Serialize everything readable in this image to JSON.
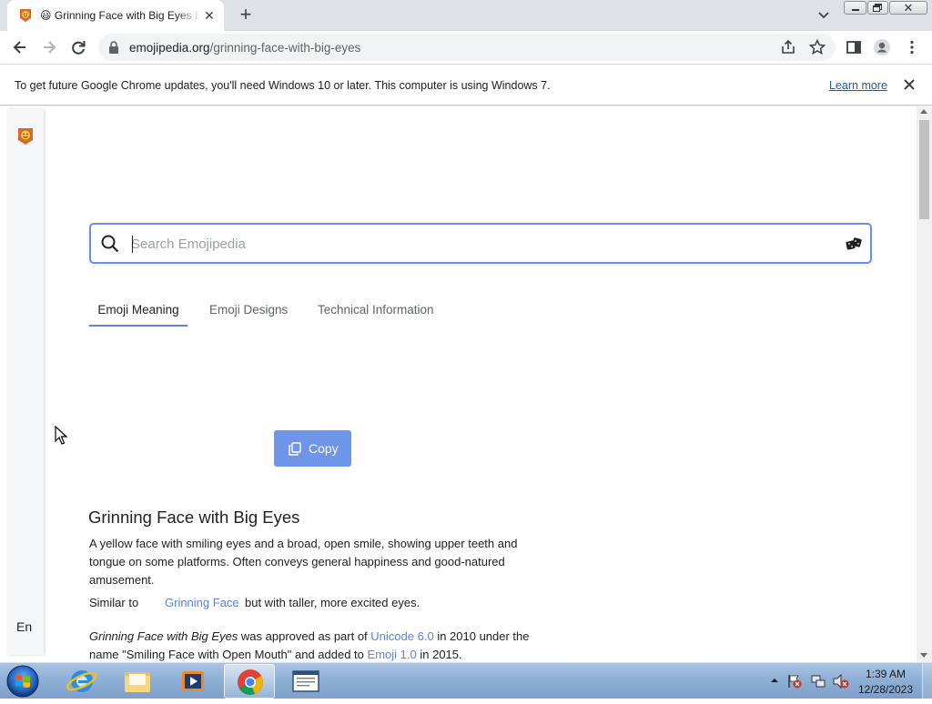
{
  "browser": {
    "tab_title": "Grinning Face with Big Eyes Emojipedia",
    "tab_title_emoji": "😃",
    "url_host": "emojipedia.org",
    "url_path": "/grinning-face-with-big-eyes"
  },
  "infobar": {
    "message": "To get future Google Chrome updates, you'll need Windows 10 or later. This computer is using Windows 7.",
    "learn_more": "Learn more"
  },
  "page": {
    "search_placeholder": "Search Emojipedia",
    "tabs": [
      "Emoji Meaning",
      "Emoji Designs",
      "Technical Information"
    ],
    "active_tab": "Emoji Meaning",
    "copy_label": "Copy",
    "heading": "Grinning Face with Big Eyes",
    "description": "A yellow face with smiling eyes and a broad, open smile, showing upper teeth and tongue on some platforms. Often conveys general happiness and good-natured amusement.",
    "similar_label": "Similar to",
    "similar_link": "Grinning Face",
    "similar_rest": "but with taller, more excited eyes.",
    "approved": {
      "name": "Grinning Face with Big Eyes",
      "text1": "was approved as part of",
      "unicode_link": "Unicode 6.0",
      "text2": "in 2010 under the name \"Smiling Face with Open Mouth\" and added to",
      "emoji_link": "Emoji 1.0",
      "text3": "in 2015."
    },
    "language": "En"
  },
  "taskbar": {
    "time": "1:39 AM",
    "date": "12/28/2023"
  },
  "colors": {
    "accent": "#5b83e3",
    "search_border": "#6b8fe6",
    "copy_button": "#6e95e8",
    "tab_strip": "#dee1e6",
    "taskbar": "#8fb0d6"
  },
  "icons": [
    "emojipedia-logo-icon",
    "close-icon",
    "new-tab-icon",
    "tab-search-icon",
    "back-icon",
    "forward-icon",
    "reload-icon",
    "lock-icon",
    "share-icon",
    "bookmark-star-icon",
    "side-panel-icon",
    "profile-icon",
    "kebab-menu-icon",
    "search-icon",
    "dice-icon",
    "copy-icon",
    "windows-start-icon",
    "internet-explorer-icon",
    "file-explorer-icon",
    "media-player-icon",
    "chrome-icon",
    "notepad-icon"
  ]
}
